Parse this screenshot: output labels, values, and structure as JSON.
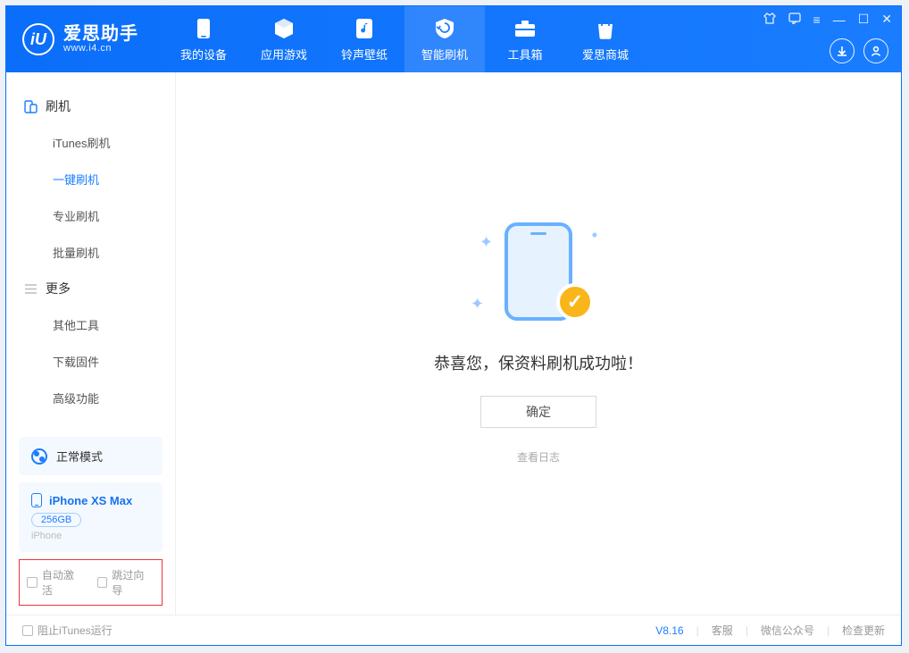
{
  "logo": {
    "title": "爱思助手",
    "url": "www.i4.cn",
    "badge": "iU"
  },
  "nav": [
    {
      "label": "我的设备",
      "icon": "device-icon"
    },
    {
      "label": "应用游戏",
      "icon": "cube-icon"
    },
    {
      "label": "铃声壁纸",
      "icon": "music-sheet-icon"
    },
    {
      "label": "智能刷机",
      "icon": "shield-refresh-icon",
      "active": true
    },
    {
      "label": "工具箱",
      "icon": "toolbox-icon"
    },
    {
      "label": "爱思商城",
      "icon": "bag-icon"
    }
  ],
  "window_controls": {
    "shirt": "⌂",
    "book": "▭",
    "settings": "≡",
    "min": "—",
    "max": "☐",
    "close": "✕"
  },
  "circle_buttons": {
    "download": "↓",
    "user": "👤"
  },
  "sidebar": {
    "section1": {
      "title": "刷机",
      "icon": "phone-tablet-icon",
      "items": [
        {
          "label": "iTunes刷机"
        },
        {
          "label": "一键刷机",
          "active": true
        },
        {
          "label": "专业刷机"
        },
        {
          "label": "批量刷机"
        }
      ]
    },
    "section2": {
      "title": "更多",
      "icon": "hamburger-icon",
      "items": [
        {
          "label": "其他工具"
        },
        {
          "label": "下载固件"
        },
        {
          "label": "高级功能"
        }
      ]
    }
  },
  "mode_card": {
    "label": "正常模式"
  },
  "device_card": {
    "name": "iPhone XS Max",
    "capacity": "256GB",
    "subtitle": "iPhone"
  },
  "checkbox_row": {
    "auto_activate": "自动激活",
    "skip_guide": "跳过向导"
  },
  "main": {
    "message": "恭喜您，保资料刷机成功啦！",
    "ok": "确定",
    "log_link": "查看日志"
  },
  "footer": {
    "stop_itunes": "阻止iTunes运行",
    "version": "V8.16",
    "links": [
      "客服",
      "微信公众号",
      "检查更新"
    ]
  }
}
